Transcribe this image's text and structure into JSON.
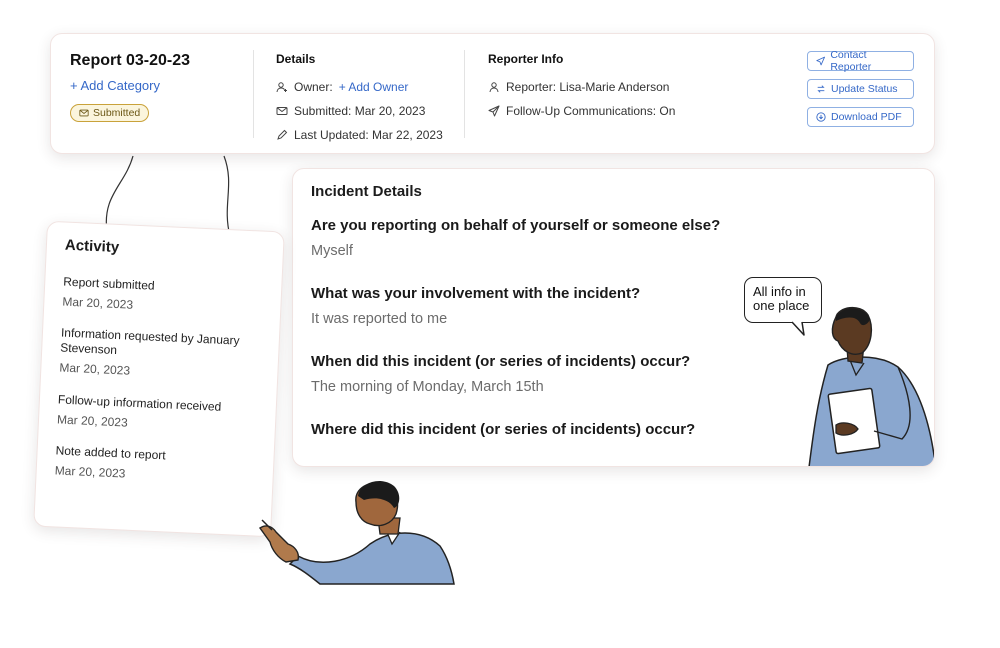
{
  "header": {
    "report_title": "Report 03-20-23",
    "add_category": "+ Add Category",
    "status": "Submitted",
    "details": {
      "title": "Details",
      "owner_label": "Owner:",
      "owner_link": "+ Add Owner",
      "submitted": "Submitted: Mar 20, 2023",
      "last_updated": "Last Updated: Mar 22, 2023"
    },
    "reporter": {
      "title": "Reporter Info",
      "reporter": "Reporter: Lisa-Marie Anderson",
      "follow_up": "Follow-Up Communications: On"
    },
    "actions": {
      "contact": "Contact Reporter",
      "update": "Update Status",
      "download": "Download PDF"
    }
  },
  "incident": {
    "title": "Incident Details",
    "questions": [
      {
        "q": "Are you reporting on behalf of yourself or someone else?",
        "a": "Myself"
      },
      {
        "q": "What was your involvement with the incident?",
        "a": "It was reported to me"
      },
      {
        "q": "When did this incident (or series of incidents) occur?",
        "a": "The morning of Monday, March 15th"
      },
      {
        "q": "Where did this incident (or series of incidents) occur?",
        "a": ""
      }
    ]
  },
  "activity": {
    "title": "Activity",
    "items": [
      {
        "text": "Report submitted",
        "date": "Mar 20, 2023"
      },
      {
        "text": "Information requested by January Stevenson",
        "date": "Mar 20, 2023"
      },
      {
        "text": "Follow-up information received",
        "date": "Mar 20, 2023"
      },
      {
        "text": "Note added to report",
        "date": "Mar 20, 2023"
      }
    ]
  },
  "speech_bubble": "All info in one place",
  "colors": {
    "link": "#3568c8",
    "badge_border": "#c9a23a",
    "shirt": "#8aa7cf",
    "skin": "#a0673d"
  }
}
